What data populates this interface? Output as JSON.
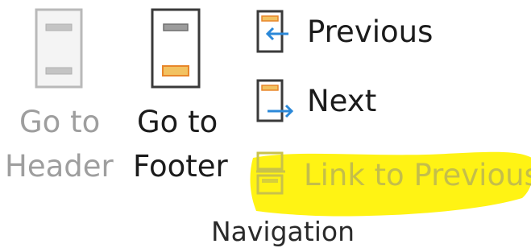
{
  "navigation_group": {
    "label": "Navigation",
    "go_to_header": {
      "line1": "Go to",
      "line2": "Header",
      "enabled": false,
      "icon": "header-page-icon"
    },
    "go_to_footer": {
      "line1": "Go to",
      "line2": "Footer",
      "enabled": true,
      "icon": "footer-page-icon"
    },
    "previous": {
      "label": "Previous",
      "enabled": true,
      "icon": "previous-section-icon"
    },
    "next": {
      "label": "Next",
      "enabled": true,
      "icon": "next-section-icon"
    },
    "link_to_previous": {
      "label": "Link to Previous",
      "enabled": false,
      "icon": "link-to-previous-icon"
    }
  },
  "colors": {
    "accent_orange": "#E8862A",
    "arrow_blue": "#2B88D8",
    "highlight_yellow": "#FFF200",
    "disabled_text": "#9E9E9E",
    "enabled_text": "#1B1B1B"
  }
}
